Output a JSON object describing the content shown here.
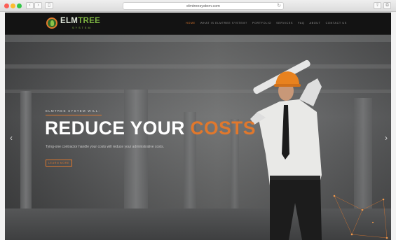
{
  "browser": {
    "url": "elmtreesystem.com",
    "back": "‹",
    "forward": "›",
    "reload": "↻"
  },
  "site": {
    "logo": {
      "word1": "ELM",
      "word2": "TREE",
      "sub": "SYSTEM"
    },
    "menu": [
      {
        "label": "HOME",
        "active": true
      },
      {
        "label": "WHAT IS ELMTREE SYSTEM?",
        "active": false
      },
      {
        "label": "PORTFOLIO",
        "active": false
      },
      {
        "label": "SERVICES",
        "active": false
      },
      {
        "label": "FAQ",
        "active": false
      },
      {
        "label": "ABOUT",
        "active": false
      },
      {
        "label": "CONTACT US",
        "active": false
      }
    ]
  },
  "hero": {
    "eyebrow": "ELMTREE SYSTEM WILL:",
    "headline_main": "REDUCE YOUR ",
    "headline_accent": "COSTS",
    "subtext": "Tying-one contractor handle your costs will reduce your administrative costs.",
    "cta": "LEARN MORE",
    "prev": "‹",
    "next": "›"
  },
  "colors": {
    "accent": "#e0782d",
    "nav_bg": "#131313",
    "logo_green": "#7cb342"
  }
}
